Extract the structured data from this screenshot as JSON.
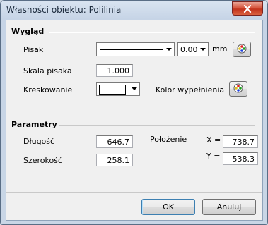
{
  "window": {
    "title": "Własności obiektu: Polilinia"
  },
  "appearance": {
    "section_title": "Wygląd",
    "pen_label": "Pisak",
    "pen_width_value": "0.00",
    "pen_width_unit": "mm",
    "pen_scale_label": "Skala pisaka",
    "pen_scale_value": "1.000",
    "hatch_label": "Kreskowanie",
    "fill_color_label": "Kolor wypełnienia"
  },
  "parameters": {
    "section_title": "Parametry",
    "length_label": "Długość",
    "length_value": "646.7",
    "width_label": "Szerokość",
    "width_value": "258.1",
    "position_label": "Położenie",
    "x_label": "X =",
    "x_value": "738.7",
    "y_label": "Y =",
    "y_value": "538.3"
  },
  "buttons": {
    "ok": "OK",
    "cancel": "Anuluj"
  },
  "icons": {
    "close": "close-icon",
    "palette": "color-palette-icon",
    "dropdown": "chevron-down-icon"
  },
  "colors": {
    "title_bar": "#d9e4f1",
    "close_button": "#c2331c",
    "client_background": "#f0f0f0"
  }
}
